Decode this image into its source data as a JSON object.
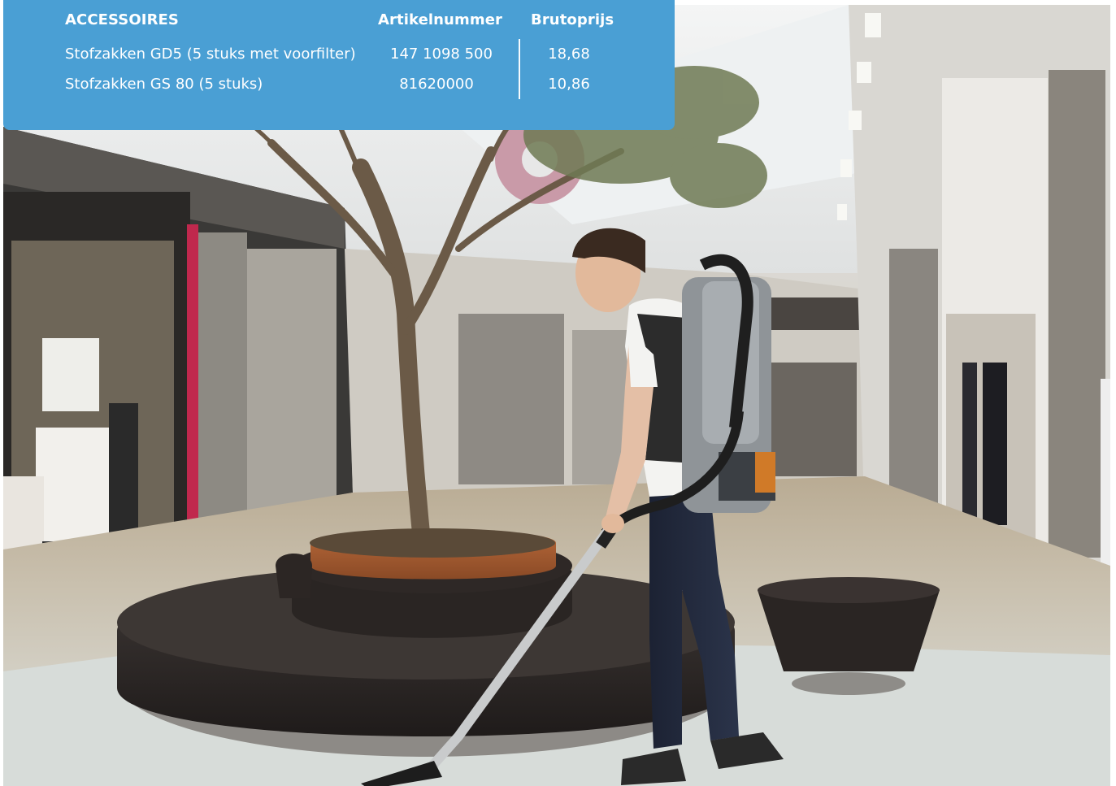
{
  "table": {
    "headers": {
      "name": "ACCESSOIRES",
      "article": "Artikelnummer",
      "price": "Brutoprijs"
    },
    "rows": [
      {
        "name": "Stofzakken GD5 (5 stuks met voorfilter)",
        "article": "147 1098 500",
        "price": "18,68"
      },
      {
        "name": "Stofzakken GS 80 (5 stuks)",
        "article": "81620000",
        "price": "10,86"
      }
    ]
  },
  "colors": {
    "panel": "#4a9fd4",
    "text": "#ffffff"
  }
}
